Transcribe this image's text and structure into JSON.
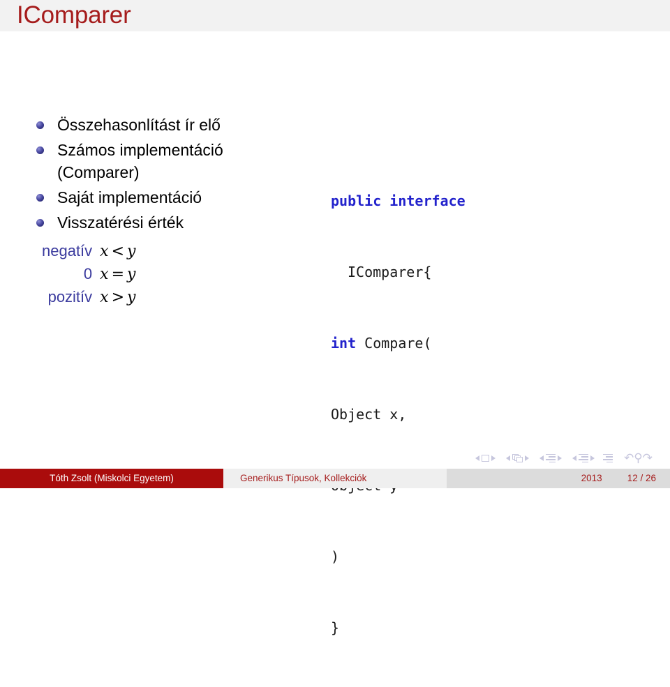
{
  "slide": {
    "title": "IComparer"
  },
  "bullets": [
    {
      "text": "Összehasonlítást ír elő"
    },
    {
      "text": "Számos implementáció (Comparer)"
    },
    {
      "text": "Saját implementáció"
    },
    {
      "text": "Visszatérési érték"
    }
  ],
  "return_values": [
    {
      "term": "negatív",
      "lhs": "x",
      "op": "<",
      "rhs": "y"
    },
    {
      "term": "0",
      "lhs": "x",
      "op": "=",
      "rhs": "y"
    },
    {
      "term": "pozitív",
      "lhs": "x",
      "op": ">",
      "rhs": "y"
    }
  ],
  "code": {
    "lines": [
      {
        "indent": 0,
        "keyword": "public interface",
        "rest": ""
      },
      {
        "indent": 2,
        "keyword": "",
        "rest": "IComparer{"
      },
      {
        "indent": 0,
        "keyword": "int",
        "rest": " Compare("
      },
      {
        "indent": 0,
        "keyword": "",
        "rest": "Object x,"
      },
      {
        "indent": 0,
        "keyword": "",
        "rest": "Object y"
      },
      {
        "indent": 0,
        "keyword": "",
        "rest": ")"
      },
      {
        "indent": 0,
        "keyword": "",
        "rest": "}"
      }
    ]
  },
  "navigation": {
    "symbols": [
      "slide-back-icon",
      "slide-icon",
      "slide-forward-icon",
      "frame-back-icon",
      "frame-icon",
      "frame-forward-icon",
      "subsection-back-icon",
      "subsection-icon",
      "subsection-forward-icon",
      "section-back-icon",
      "section-icon",
      "section-forward-icon",
      "document-icon",
      "go-back-icon",
      "search-icon",
      "go-forward-icon"
    ]
  },
  "footer": {
    "author": "Tóth Zsolt  (Miskolci Egyetem)",
    "title": "Generikus Típusok, Kollekciók",
    "year": "2013",
    "page": "12 / 26"
  },
  "colors": {
    "title_red": "#a51c1c",
    "footer_red": "#aa0c0c",
    "keyword_blue": "#2222cc",
    "term_blue": "#3b3b9e",
    "bullet_blue": "#4b4ba3",
    "header_band": "#f2f2f2",
    "nav_gray": "#c6c6dd"
  }
}
